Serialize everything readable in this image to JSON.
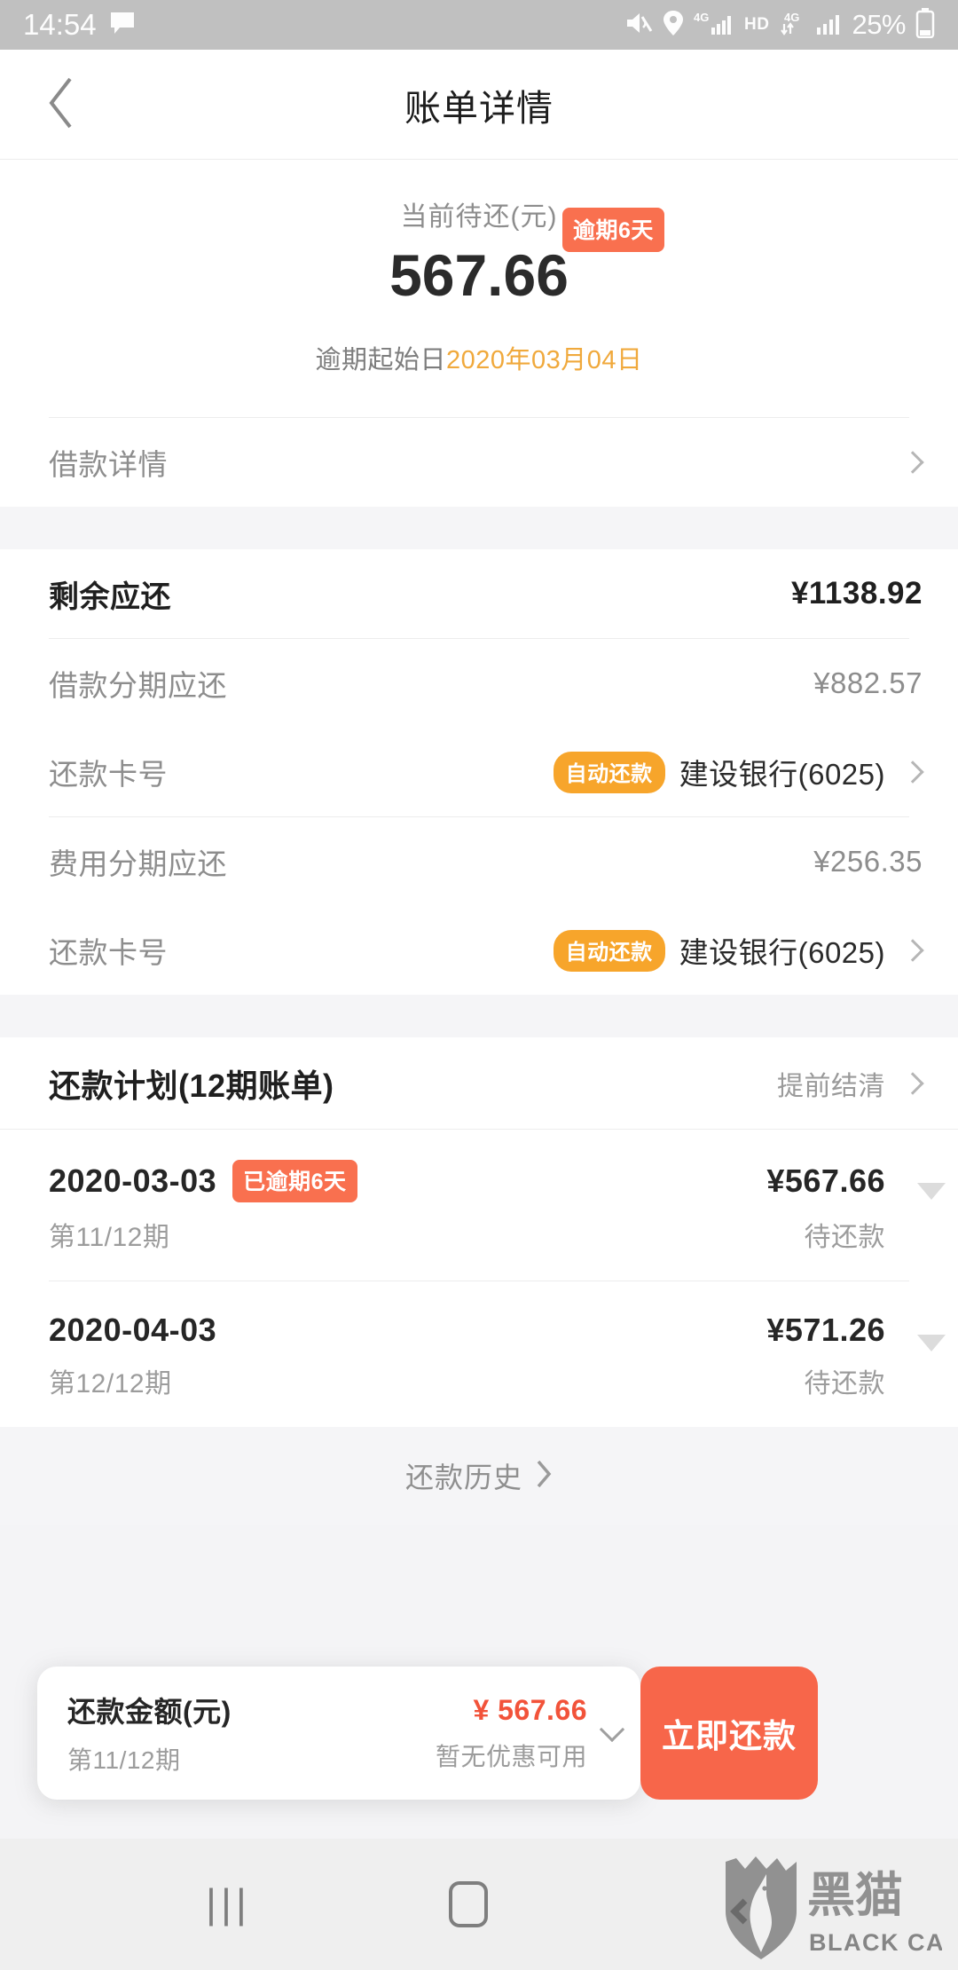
{
  "status_bar": {
    "time": "14:54",
    "battery_percent": "25%",
    "hd_label": "HD",
    "net_label_1": "4G",
    "net_label_2": "4G",
    "icons": [
      "message-bubble-icon",
      "mute-icon",
      "location-icon",
      "signal-4g-icon",
      "hd-icon",
      "data-transfer-icon",
      "signal-bars-icon",
      "battery-icon"
    ]
  },
  "header": {
    "title": "账单详情",
    "back_icon": "back-chevron-icon"
  },
  "hero": {
    "label": "当前待还(元)",
    "amount": "567.66",
    "overdue_badge": "逾期6天",
    "overdue_prefix": "逾期起始日",
    "overdue_date": "2020年03月04日"
  },
  "loan_detail_row": {
    "label": "借款详情"
  },
  "summary": {
    "remaining": {
      "label": "剩余应还",
      "value": "¥1138.92"
    },
    "groups": [
      {
        "amount_label": "借款分期应还",
        "amount_value": "¥882.57",
        "card_label": "还款卡号",
        "card_badge": "自动还款",
        "card_value": "建设银行(6025)"
      },
      {
        "amount_label": "费用分期应还",
        "amount_value": "¥256.35",
        "card_label": "还款卡号",
        "card_badge": "自动还款",
        "card_value": "建设银行(6025)"
      }
    ]
  },
  "plan": {
    "title": "还款计划(12期账单)",
    "settle_link": "提前结清",
    "installments": [
      {
        "date": "2020-03-03",
        "badge": "已逾期6天",
        "amount": "¥567.66",
        "period": "第11/12期",
        "status": "待还款"
      },
      {
        "date": "2020-04-03",
        "badge": "",
        "amount": "¥571.26",
        "period": "第12/12期",
        "status": "待还款"
      }
    ]
  },
  "history": {
    "label": "还款历史"
  },
  "paybar": {
    "title": "还款金额(元)",
    "subtitle": "第11/12期",
    "amount": "¥ 567.66",
    "promo": "暂无优惠可用",
    "button_label": "立即还款"
  },
  "navbar": {
    "recents_icon": "|||",
    "home_icon": "home-square-icon",
    "back_icon": "back-triangle-icon"
  },
  "watermark": {
    "brand_cn": "黑猫",
    "brand_en": "BLACK CAT"
  },
  "colors": {
    "accent_red": "#f7664a",
    "badge_red": "#f9704f",
    "badge_orange": "#f7a52b",
    "date_orange": "#f0a93c",
    "statusbar_gray": "#c0c0c0",
    "page_bg": "#f4f4f6"
  }
}
